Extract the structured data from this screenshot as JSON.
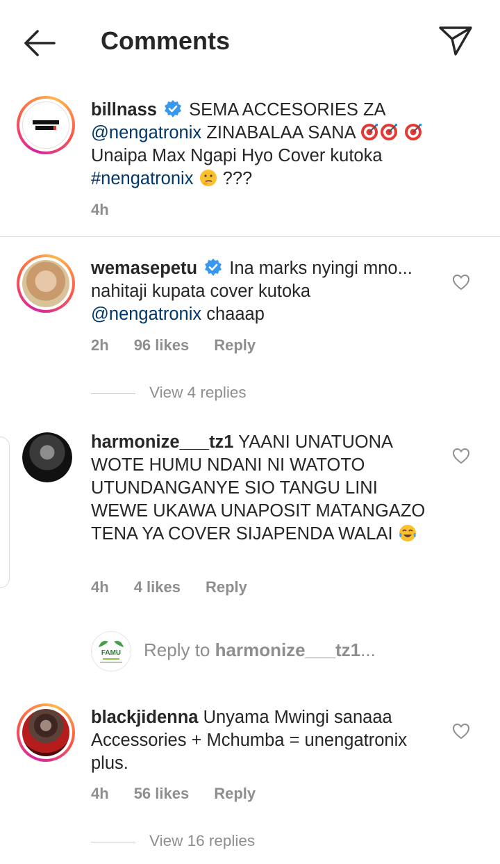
{
  "header": {
    "title": "Comments"
  },
  "comments": [
    {
      "username": "billnass",
      "avatar_text": "NENGA TRONIX",
      "text_parts": [
        "SEMA ACCESORIES ZA ",
        "@nengatronix",
        " ZINABALAA SANA ",
        " Unaipa Max Ngapi Hyo Cover kutoka ",
        "#nengatronix",
        " ???"
      ],
      "time": "4h"
    },
    {
      "username": "wemasepetu",
      "text_parts": [
        "Ina marks nyingi mno... nahitaji kupata cover kutoka ",
        "@nengatronix",
        " chaaap"
      ],
      "time": "2h",
      "likes": "96 likes",
      "reply_label": "Reply",
      "view_replies": "View 4 replies"
    },
    {
      "username": "harmonize___tz1",
      "text": "YAANI UNATUONA WOTE HUMU NDANI NI WATOTO UTUNDANGANYE SIO TANGU LINI WEWE UKAWA UNAPOSIT MATANGAZO TENA YA COVER SIJAPENDA WALAI",
      "time": "4h",
      "likes": "4 likes",
      "reply_label": "Reply"
    },
    {
      "username": "blackjidenna",
      "text": "Unyama Mwingi sanaaa Accessories + Mchumba = unengatronix plus.",
      "time": "4h",
      "likes": "56 likes",
      "reply_label": "Reply",
      "view_replies": "View 16 replies"
    }
  ],
  "reply_box": {
    "prefix": "Reply to ",
    "target": "harmonize___tz1",
    "suffix": "...",
    "avatar_text": "FAMU"
  },
  "colors": {
    "text": "#262626",
    "secondary": "#8e8e8e",
    "mention": "#00376b",
    "verified": "#3897f0"
  }
}
